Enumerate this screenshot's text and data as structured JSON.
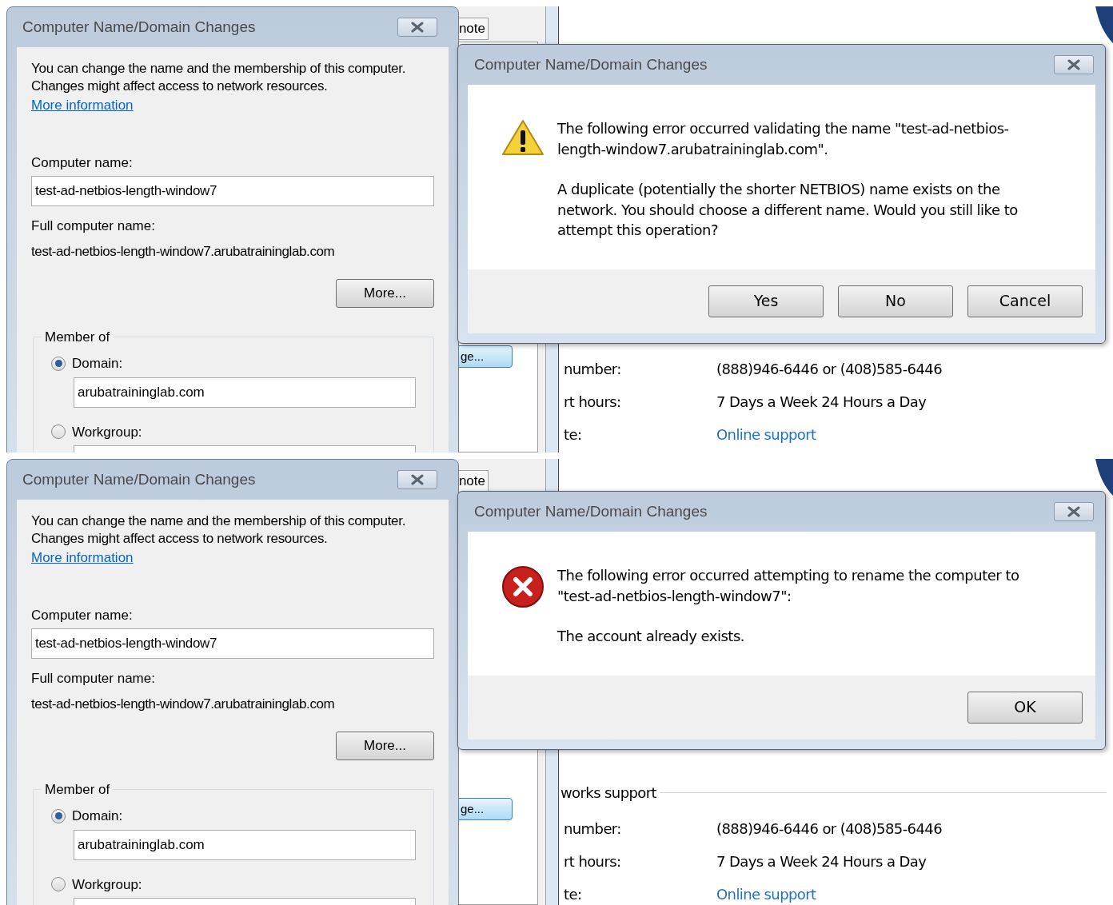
{
  "panels": [
    {
      "name_dialog": {
        "title": "Computer Name/Domain Changes",
        "description": "You can change the name and the membership of this computer. Changes might affect access to network resources.",
        "link": "More information",
        "computer_name_label": "Computer name:",
        "computer_name_value": "test-ad-netbios-length-window7",
        "full_name_label": "Full computer name:",
        "full_name_value": "test-ad-netbios-length-window7.arubatraininglab.com",
        "more_button": "More...",
        "member_of": {
          "title": "Member of",
          "options": [
            {
              "label": "Domain:",
              "selected": true,
              "value": "arubatraininglab.com"
            },
            {
              "label": "Workgroup:",
              "selected": false
            }
          ]
        }
      },
      "background": {
        "tab_label": "note",
        "button_label": "ge...",
        "rows": [
          {
            "label": "number:",
            "value": "(888)946-6446 or (408)585-6446",
            "kind": "text"
          },
          {
            "label": "rt hours:",
            "value": "7 Days a Week 24 Hours a Day",
            "kind": "text"
          },
          {
            "label": "te:",
            "value": "Online support",
            "kind": "link"
          }
        ]
      },
      "message_box": {
        "title": "Computer Name/Domain Changes",
        "kind": "warning",
        "paragraphs": [
          "The following error occurred validating the name \"test-ad-netbios-length-window7.arubatraininglab.com\".",
          "A duplicate (potentially the shorter NETBIOS) name exists on the network. You should choose a different name. Would you still like to attempt this operation?"
        ],
        "buttons": [
          "Yes",
          "No",
          "Cancel"
        ]
      }
    },
    {
      "name_dialog": {
        "title": "Computer Name/Domain Changes",
        "description": "You can change the name and the membership of this computer. Changes might affect access to network resources.",
        "link": "More information",
        "computer_name_label": "Computer name:",
        "computer_name_value": "test-ad-netbios-length-window7",
        "full_name_label": "Full computer name:",
        "full_name_value": "test-ad-netbios-length-window7.arubatraininglab.com",
        "more_button": "More...",
        "member_of": {
          "title": "Member of",
          "options": [
            {
              "label": "Domain:",
              "selected": true,
              "value": "arubatraininglab.com"
            },
            {
              "label": "Workgroup:",
              "selected": false
            }
          ]
        }
      },
      "background": {
        "tab_label": "note",
        "button_label": "ge...",
        "section_title": "works support",
        "rows": [
          {
            "label": "number:",
            "value": "(888)946-6446 or (408)585-6446",
            "kind": "text"
          },
          {
            "label": "rt hours:",
            "value": "7 Days a Week 24 Hours a Day",
            "kind": "text"
          },
          {
            "label": "te:",
            "value": "Online support",
            "kind": "link"
          }
        ]
      },
      "message_box": {
        "title": "Computer Name/Domain Changes",
        "kind": "error",
        "paragraphs": [
          "The following error occurred attempting to rename the computer to \"test-ad-netbios-length-window7\":",
          "The account already exists."
        ],
        "buttons": [
          "OK"
        ]
      }
    }
  ]
}
